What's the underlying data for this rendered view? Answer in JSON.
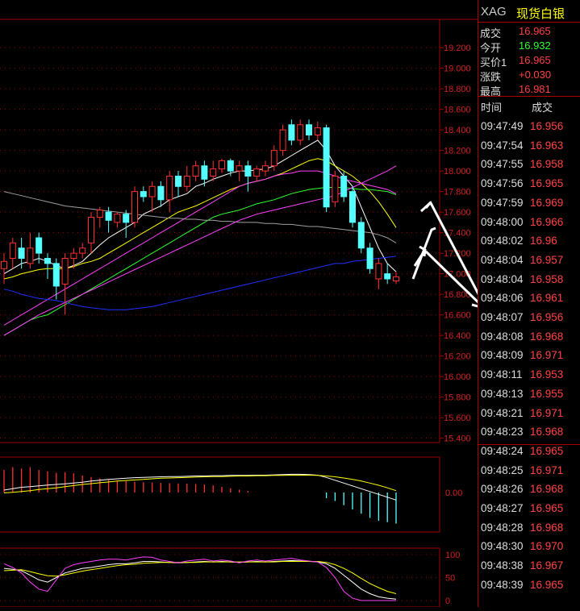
{
  "colors": {
    "up": "#ff3030",
    "down": "#54ffff",
    "axis": "#a00000",
    "label": "#d02020",
    "white": "#ffffff",
    "yellow": "#ffff00",
    "magenta": "#ff40ff",
    "green": "#30ff30",
    "blue": "#2030ff",
    "gray": "#a0a0a0",
    "quote_red": "#ff4040",
    "quote_green": "#30ff30"
  },
  "header": {
    "symbol": "XAG",
    "name": "现货白银"
  },
  "quote": [
    {
      "label": "成交",
      "value": "16.965",
      "color": "#ff4040"
    },
    {
      "label": "今开",
      "value": "16.932",
      "color": "#30ff30"
    },
    {
      "label": "买价1",
      "value": "16.965",
      "color": "#ff4040"
    },
    {
      "label": "涨跌",
      "value": "+0.030",
      "color": "#ff4040"
    },
    {
      "label": "最高",
      "value": "16.981",
      "color": "#ff4040"
    }
  ],
  "ticks_header": {
    "time": "时间",
    "price": "成交"
  },
  "ticks": [
    {
      "time": "09:47:49",
      "price": "16.956"
    },
    {
      "time": "09:47:54",
      "price": "16.963"
    },
    {
      "time": "09:47:55",
      "price": "16.958"
    },
    {
      "time": "09:47:56",
      "price": "16.965"
    },
    {
      "time": "09:47:59",
      "price": "16.969"
    },
    {
      "time": "09:48:00",
      "price": "16.966"
    },
    {
      "time": "09:48:02",
      "price": "16.96"
    },
    {
      "time": "09:48:04",
      "price": "16.957"
    },
    {
      "time": "09:48:04",
      "price": "16.958"
    },
    {
      "time": "09:48:06",
      "price": "16.961"
    },
    {
      "time": "09:48:07",
      "price": "16.956"
    },
    {
      "time": "09:48:08",
      "price": "16.968"
    },
    {
      "time": "09:48:09",
      "price": "16.971"
    },
    {
      "time": "09:48:11",
      "price": "16.953"
    },
    {
      "time": "09:48:13",
      "price": "16.955"
    },
    {
      "time": "09:48:21",
      "price": "16.971"
    },
    {
      "time": "09:48:23",
      "price": "16.968"
    },
    {
      "time": "09:48:24",
      "price": "16.965"
    },
    {
      "time": "09:48:25",
      "price": "16.971"
    },
    {
      "time": "09:48:26",
      "price": "16.968"
    },
    {
      "time": "09:48:27",
      "price": "16.965"
    },
    {
      "time": "09:48:28",
      "price": "16.968"
    },
    {
      "time": "09:48:30",
      "price": "16.970"
    },
    {
      "time": "09:48:38",
      "price": "16.967"
    },
    {
      "time": "09:48:39",
      "price": "16.965"
    }
  ],
  "chart_data": [
    {
      "type": "candlestick",
      "y_ticks": [
        "19.200",
        "19.000",
        "18.800",
        "18.600",
        "18.400",
        "18.200",
        "18.000",
        "17.800",
        "17.600",
        "17.400",
        "17.200",
        "17.000",
        "16.800",
        "16.600",
        "16.400",
        "16.200",
        "16.000",
        "15.800",
        "15.600",
        "15.400"
      ],
      "ylim": [
        15.35,
        19.35
      ],
      "candles": [
        {
          "o": 17.05,
          "c": 17.12,
          "h": 17.2,
          "l": 16.9
        },
        {
          "o": 17.15,
          "c": 17.3,
          "h": 17.35,
          "l": 17.05
        },
        {
          "o": 17.25,
          "c": 17.15,
          "h": 17.35,
          "l": 17.05
        },
        {
          "o": 17.1,
          "c": 17.25,
          "h": 17.4,
          "l": 17.05
        },
        {
          "o": 17.35,
          "c": 17.2,
          "h": 17.4,
          "l": 17.1
        },
        {
          "o": 17.15,
          "c": 17.1,
          "h": 17.2,
          "l": 16.95
        },
        {
          "o": 17.1,
          "c": 16.88,
          "h": 17.15,
          "l": 16.75
        },
        {
          "o": 16.9,
          "c": 17.15,
          "h": 17.2,
          "l": 16.6
        },
        {
          "o": 17.15,
          "c": 17.2,
          "h": 17.25,
          "l": 17.05
        },
        {
          "o": 17.2,
          "c": 17.25,
          "h": 17.3,
          "l": 17.15
        },
        {
          "o": 17.3,
          "c": 17.55,
          "h": 17.6,
          "l": 17.2
        },
        {
          "o": 17.55,
          "c": 17.62,
          "h": 17.65,
          "l": 17.45
        },
        {
          "o": 17.6,
          "c": 17.52,
          "h": 17.65,
          "l": 17.4
        },
        {
          "o": 17.5,
          "c": 17.58,
          "h": 17.6,
          "l": 17.45
        },
        {
          "o": 17.58,
          "c": 17.5,
          "h": 17.62,
          "l": 17.35
        },
        {
          "o": 17.5,
          "c": 17.8,
          "h": 17.85,
          "l": 17.45
        },
        {
          "o": 17.8,
          "c": 17.75,
          "h": 17.85,
          "l": 17.7
        },
        {
          "o": 17.75,
          "c": 17.85,
          "h": 17.9,
          "l": 17.6
        },
        {
          "o": 17.85,
          "c": 17.72,
          "h": 17.9,
          "l": 17.65
        },
        {
          "o": 17.72,
          "c": 17.95,
          "h": 18.0,
          "l": 17.6
        },
        {
          "o": 17.95,
          "c": 17.85,
          "h": 18.0,
          "l": 17.75
        },
        {
          "o": 17.85,
          "c": 17.95,
          "h": 18.05,
          "l": 17.8
        },
        {
          "o": 17.95,
          "c": 18.05,
          "h": 18.1,
          "l": 17.9
        },
        {
          "o": 18.05,
          "c": 17.92,
          "h": 18.1,
          "l": 17.85
        },
        {
          "o": 17.95,
          "c": 18.02,
          "h": 18.1,
          "l": 17.9
        },
        {
          "o": 18.02,
          "c": 18.1,
          "h": 18.12,
          "l": 17.98
        },
        {
          "o": 18.1,
          "c": 18.0,
          "h": 18.12,
          "l": 17.95
        },
        {
          "o": 18.0,
          "c": 18.05,
          "h": 18.1,
          "l": 17.9
        },
        {
          "o": 18.05,
          "c": 17.95,
          "h": 18.1,
          "l": 17.8
        },
        {
          "o": 17.95,
          "c": 18.02,
          "h": 18.05,
          "l": 17.9
        },
        {
          "o": 18.0,
          "c": 18.05,
          "h": 18.1,
          "l": 17.95
        },
        {
          "o": 18.05,
          "c": 18.2,
          "h": 18.25,
          "l": 18.0
        },
        {
          "o": 18.2,
          "c": 18.4,
          "h": 18.45,
          "l": 18.15
        },
        {
          "o": 18.45,
          "c": 18.3,
          "h": 18.5,
          "l": 18.25
        },
        {
          "o": 18.3,
          "c": 18.45,
          "h": 18.5,
          "l": 18.25
        },
        {
          "o": 18.45,
          "c": 18.35,
          "h": 18.5,
          "l": 18.3
        },
        {
          "o": 18.35,
          "c": 18.42,
          "h": 18.48,
          "l": 18.3
        },
        {
          "o": 18.42,
          "c": 17.65,
          "h": 18.45,
          "l": 17.6
        },
        {
          "o": 17.7,
          "c": 17.95,
          "h": 18.0,
          "l": 17.65
        },
        {
          "o": 17.95,
          "c": 17.75,
          "h": 18.0,
          "l": 17.7
        },
        {
          "o": 17.8,
          "c": 17.5,
          "h": 17.85,
          "l": 17.45
        },
        {
          "o": 17.5,
          "c": 17.25,
          "h": 17.55,
          "l": 17.2
        },
        {
          "o": 17.25,
          "c": 17.05,
          "h": 17.3,
          "l": 17.0
        },
        {
          "o": 16.95,
          "c": 17.1,
          "h": 17.15,
          "l": 16.85
        },
        {
          "o": 17.0,
          "c": 16.95,
          "h": 17.1,
          "l": 16.9
        },
        {
          "o": 16.93,
          "c": 16.97,
          "h": 17.02,
          "l": 16.9
        }
      ],
      "ma_lines": [
        {
          "color": "#ffffff",
          "values": [
            17.0,
            17.05,
            17.1,
            17.12,
            17.15,
            17.12,
            17.08,
            17.05,
            17.08,
            17.12,
            17.2,
            17.28,
            17.35,
            17.4,
            17.45,
            17.5,
            17.58,
            17.62,
            17.66,
            17.72,
            17.75,
            17.78,
            17.85,
            17.88,
            17.92,
            17.95,
            17.98,
            18.0,
            18.0,
            18.01,
            18.02,
            18.05,
            18.1,
            18.15,
            18.2,
            18.25,
            18.3,
            18.2,
            18.05,
            17.95,
            17.85,
            17.65,
            17.45,
            17.25,
            17.1,
            17.02
          ]
        },
        {
          "color": "#ffff00",
          "values": [
            16.95,
            16.97,
            17.0,
            17.02,
            17.04,
            17.05,
            17.05,
            17.05,
            17.07,
            17.1,
            17.12,
            17.15,
            17.2,
            17.25,
            17.3,
            17.35,
            17.4,
            17.45,
            17.5,
            17.55,
            17.6,
            17.63,
            17.66,
            17.7,
            17.74,
            17.78,
            17.82,
            17.85,
            17.88,
            17.9,
            17.92,
            17.95,
            17.98,
            18.02,
            18.06,
            18.1,
            18.12,
            18.1,
            18.05,
            18.0,
            17.95,
            17.88,
            17.8,
            17.7,
            17.58,
            17.45
          ]
        },
        {
          "color": "#ff40ff",
          "values": [
            16.5,
            16.55,
            16.6,
            16.65,
            16.7,
            16.75,
            16.8,
            16.85,
            16.9,
            16.95,
            17.0,
            17.05,
            17.1,
            17.15,
            17.2,
            17.25,
            17.3,
            17.35,
            17.4,
            17.45,
            17.5,
            17.55,
            17.6,
            17.65,
            17.7,
            17.75,
            17.8,
            17.85,
            17.88,
            17.9,
            17.92,
            17.95,
            17.97,
            17.98,
            18.0,
            18.0,
            18.0,
            17.98,
            17.95,
            17.92,
            17.9,
            17.88,
            17.86,
            17.84,
            17.82,
            17.78
          ]
        },
        {
          "color": "#30ff30",
          "values": [
            16.4,
            16.45,
            16.5,
            16.55,
            16.58,
            16.6,
            16.65,
            16.7,
            16.75,
            16.8,
            16.85,
            16.9,
            16.95,
            17.0,
            17.05,
            17.1,
            17.15,
            17.2,
            17.25,
            17.3,
            17.35,
            17.4,
            17.45,
            17.5,
            17.55,
            17.58,
            17.6,
            17.62,
            17.65,
            17.68,
            17.7,
            17.72,
            17.75,
            17.78,
            17.8,
            17.82,
            17.83,
            17.84,
            17.84,
            17.84,
            17.83,
            17.82,
            17.82,
            17.81,
            17.8,
            17.77
          ]
        },
        {
          "color": "#2030ff",
          "values": [
            16.85,
            16.83,
            16.8,
            16.78,
            16.76,
            16.75,
            16.74,
            16.72,
            16.7,
            16.68,
            16.67,
            16.66,
            16.65,
            16.65,
            16.65,
            16.66,
            16.67,
            16.68,
            16.7,
            16.72,
            16.74,
            16.76,
            16.78,
            16.8,
            16.82,
            16.84,
            16.86,
            16.88,
            16.9,
            16.92,
            16.94,
            16.96,
            16.98,
            17.0,
            17.02,
            17.04,
            17.06,
            17.08,
            17.1,
            17.1,
            17.12,
            17.13,
            17.14,
            17.15,
            17.16,
            17.17
          ]
        },
        {
          "color": "#a0a0a0",
          "values": [
            17.8,
            17.78,
            17.76,
            17.74,
            17.72,
            17.7,
            17.68,
            17.66,
            17.65,
            17.64,
            17.63,
            17.62,
            17.61,
            17.6,
            17.59,
            17.58,
            17.57,
            17.56,
            17.55,
            17.54,
            17.54,
            17.53,
            17.53,
            17.52,
            17.52,
            17.51,
            17.51,
            17.5,
            17.5,
            17.5,
            17.49,
            17.49,
            17.48,
            17.48,
            17.47,
            17.46,
            17.46,
            17.45,
            17.44,
            17.43,
            17.42,
            17.41,
            17.4,
            17.38,
            17.35,
            17.3
          ]
        },
        {
          "color": "#ff40ff",
          "values": [
            16.4,
            16.45,
            16.5,
            16.55,
            16.6,
            16.64,
            16.68,
            16.72,
            16.76,
            16.8,
            16.84,
            16.88,
            16.92,
            16.96,
            17.0,
            17.04,
            17.08,
            17.12,
            17.16,
            17.2,
            17.24,
            17.28,
            17.32,
            17.36,
            17.4,
            17.44,
            17.48,
            17.52,
            17.55,
            17.58,
            17.6,
            17.62,
            17.64,
            17.66,
            17.68,
            17.7,
            17.72,
            17.74,
            17.76,
            17.8,
            17.84,
            17.88,
            17.92,
            17.96,
            18.0,
            18.05
          ]
        }
      ]
    },
    {
      "type": "macd",
      "y_ticks": [
        "0.00"
      ],
      "hist": [
        0.8,
        0.9,
        0.85,
        0.9,
        0.8,
        0.75,
        0.7,
        0.72,
        0.68,
        0.6,
        0.55,
        0.5,
        0.45,
        0.42,
        0.4,
        0.38,
        0.36,
        0.35,
        0.34,
        0.33,
        0.32,
        0.31,
        0.3,
        0.28,
        0.25,
        0.2,
        0.15,
        0.1,
        0.05,
        0.0,
        0.0,
        0.0,
        0.0,
        0.0,
        0.0,
        0.0,
        0.0,
        -0.2,
        -0.3,
        -0.45,
        -0.6,
        -0.75,
        -0.9,
        -1.0,
        -1.05,
        -1.1
      ],
      "dif": [
        0.8,
        0.85,
        0.9,
        0.92,
        0.95,
        0.98,
        1.0,
        1.02,
        1.05,
        1.08,
        1.12,
        1.15,
        1.18,
        1.2,
        1.22,
        1.24,
        1.25,
        1.26,
        1.27,
        1.28,
        1.28,
        1.29,
        1.3,
        1.3,
        1.31,
        1.31,
        1.32,
        1.32,
        1.32,
        1.33,
        1.33,
        1.34,
        1.35,
        1.36,
        1.36,
        1.35,
        1.33,
        1.25,
        1.15,
        1.05,
        0.95,
        0.85,
        0.75,
        0.65,
        0.55,
        0.45
      ],
      "dea": [
        0.7,
        0.72,
        0.75,
        0.78,
        0.82,
        0.85,
        0.88,
        0.92,
        0.96,
        1.0,
        1.03,
        1.06,
        1.09,
        1.12,
        1.14,
        1.16,
        1.18,
        1.2,
        1.22,
        1.23,
        1.24,
        1.25,
        1.26,
        1.27,
        1.28,
        1.28,
        1.29,
        1.3,
        1.3,
        1.31,
        1.31,
        1.32,
        1.32,
        1.33,
        1.33,
        1.33,
        1.32,
        1.3,
        1.27,
        1.23,
        1.18,
        1.12,
        1.05,
        0.97,
        0.88,
        0.78
      ]
    },
    {
      "type": "kdj",
      "y_ticks": [
        "100",
        "50",
        "0"
      ],
      "k": [
        70,
        68,
        65,
        55,
        45,
        40,
        50,
        60,
        65,
        70,
        72,
        75,
        78,
        80,
        80,
        82,
        85,
        85,
        84,
        83,
        82,
        83,
        84,
        85,
        84,
        85,
        84,
        83,
        84,
        85,
        84,
        85,
        86,
        87,
        86,
        85,
        84,
        80,
        70,
        55,
        40,
        25,
        15,
        8,
        5,
        3
      ],
      "d": [
        65,
        66,
        67,
        63,
        58,
        54,
        53,
        56,
        60,
        64,
        67,
        70,
        73,
        76,
        78,
        79,
        81,
        82,
        83,
        83,
        83,
        83,
        83,
        84,
        84,
        84,
        84,
        84,
        84,
        84,
        84,
        84,
        85,
        85,
        85,
        85,
        85,
        83,
        78,
        70,
        60,
        48,
        37,
        28,
        20,
        15
      ],
      "j": [
        80,
        72,
        60,
        40,
        25,
        20,
        45,
        70,
        78,
        82,
        85,
        88,
        90,
        90,
        88,
        92,
        95,
        94,
        88,
        85,
        82,
        86,
        88,
        90,
        86,
        88,
        86,
        82,
        86,
        88,
        86,
        88,
        90,
        92,
        88,
        86,
        84,
        72,
        50,
        20,
        5,
        0,
        0,
        0,
        0,
        0
      ]
    }
  ]
}
